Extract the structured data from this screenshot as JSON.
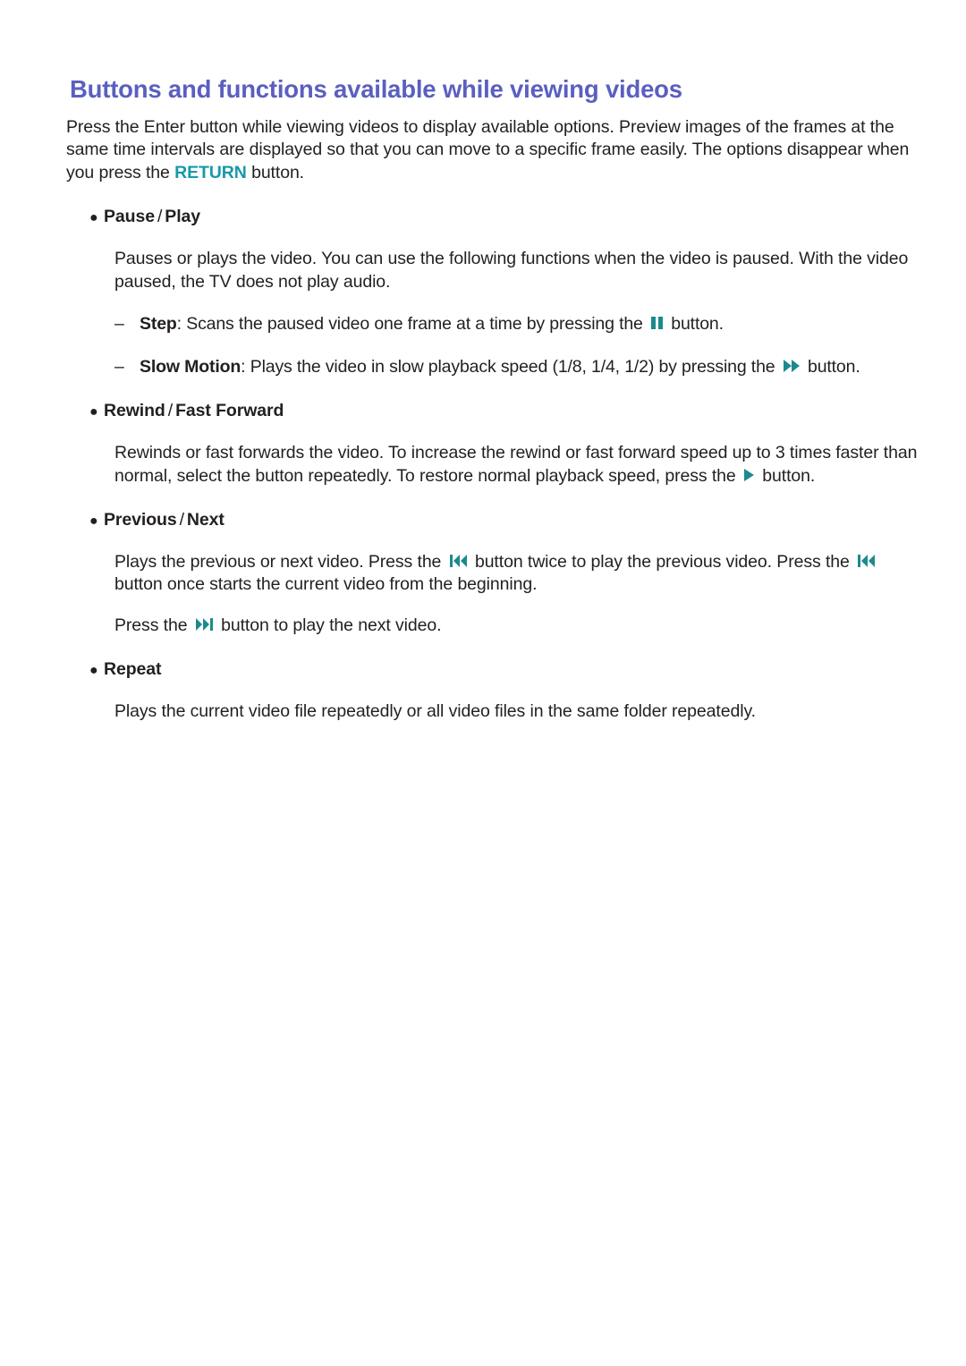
{
  "colors": {
    "title": "#5b5fc0",
    "bullet_label": "#1b6cb3",
    "keyword": "#1899a8",
    "icon": "#1b8a8f",
    "body_text": "#231f20",
    "background": "#ffffff"
  },
  "page": {
    "title": "Buttons and functions available while viewing videos",
    "intro": {
      "part1": "Press the Enter button while viewing videos to display available options. Preview images of the frames at the same time intervals are displayed so that you can move to a specific frame easily. The options disappear when you press the ",
      "keyword": "RETURN",
      "part2": " button."
    },
    "bullet_marker": "●",
    "dash_marker": "–",
    "separator": "/",
    "sections": [
      {
        "label_a": "Pause",
        "label_b": "Play",
        "body": "Pauses or plays the video. You can use the following functions when the video is paused. With the video paused, the TV does not play audio.",
        "sub_items": [
          {
            "term": "Step",
            "text_before": ": Scans the paused video one frame at a time by pressing the ",
            "icon": "pause-icon",
            "text_after": " button."
          },
          {
            "term": "Slow Motion",
            "text_before": ": Plays the video in slow playback speed (1/8, 1/4, 1/2) by pressing the ",
            "icon": "fast-forward-icon",
            "text_after": " button."
          }
        ]
      },
      {
        "label_a": "Rewind",
        "label_b": "Fast Forward",
        "body_before": "Rewinds or fast forwards the video. To increase the rewind or fast forward speed up to 3 times faster than normal, select the button repeatedly. To restore normal playback speed, press the ",
        "icon": "play-icon",
        "body_after": " button."
      },
      {
        "label_a": "Previous",
        "label_b": "Next",
        "body_p1_a": "Plays the previous or next video. Press the ",
        "body_p1_icon": "previous-icon",
        "body_p1_b": " button twice to play the previous video. Press the ",
        "body_p1_icon2": "previous-icon",
        "body_p1_c": " button once starts the current video from the beginning.",
        "body_p2_a": "Press the ",
        "body_p2_icon": "next-icon",
        "body_p2_b": " button to play the next video."
      },
      {
        "label_a": "Repeat",
        "body": "Plays the current video file repeatedly or all video files in the same folder repeatedly."
      }
    ]
  }
}
